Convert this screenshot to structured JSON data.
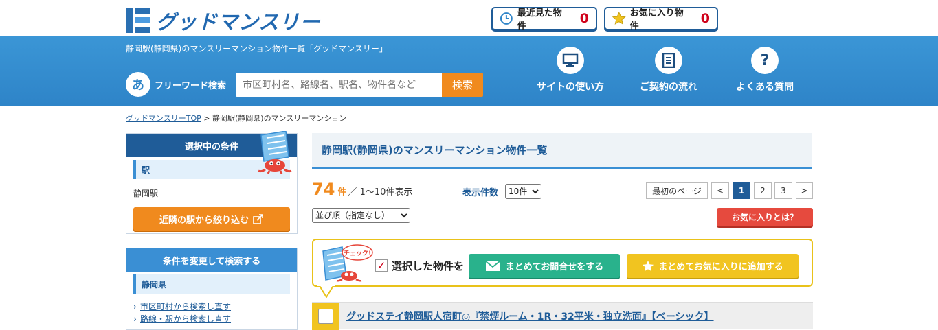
{
  "header": {
    "logo_text": "グッドマンスリー",
    "recent": {
      "label": "最近見た物件",
      "count": "0"
    },
    "favorites": {
      "label": "お気に入り物件",
      "count": "0"
    },
    "page_heading": "静岡駅(静岡県)のマンスリーマンション物件一覧「グッドマンスリー」",
    "freeword": {
      "badge": "あ",
      "label": "フリーワード検索",
      "placeholder": "市区町村名、路線名、駅名、物件名など",
      "button": "検索"
    },
    "nav": [
      {
        "label": "サイトの使い方",
        "icon": "monitor-icon"
      },
      {
        "label": "ご契約の流れ",
        "icon": "document-icon"
      },
      {
        "label": "よくある質問",
        "icon": "question-icon"
      }
    ]
  },
  "breadcrumb": {
    "home": "グッドマンスリーTOP",
    "sep": " > ",
    "current": "静岡駅(静岡県)のマンスリーマンション"
  },
  "sidebar": {
    "conditions": {
      "title": "選択中の条件",
      "sub": "駅",
      "value": "静岡駅",
      "button": "近隣の駅から絞り込む"
    },
    "change": {
      "title": "条件を変更して検索する",
      "sub": "静岡県",
      "links": [
        "市区町村から検索し直す",
        "路線・駅から検索し直す"
      ]
    }
  },
  "main": {
    "title": "静岡駅(静岡県)のマンスリーマンション物件一覧",
    "total": "74",
    "total_unit": "件",
    "range": "／ 1〜10件表示",
    "per_page_label": "表示件数",
    "per_page_value": "10件",
    "pagination": {
      "first": "最初のページ",
      "prev": "<",
      "pages": [
        "1",
        "2",
        "3"
      ],
      "next": ">",
      "current": "1"
    },
    "sort_value": "並び順（指定なし）",
    "fav_help": "お気に入りとは？",
    "selection": {
      "bubble": "チェック!",
      "label": "選択した物件を",
      "inquiry_button": "まとめてお問合せをする",
      "fav_button": "まとめてお気に入りに追加する"
    },
    "listing": {
      "title": "グッドステイ静岡駅人宿町◎『禁煙ルーム・1R・32平米・独立洗面』【ベーシック】"
    }
  },
  "colors": {
    "brand": "#1f5c98",
    "band": "#2e84c8",
    "accent": "#f08a1e",
    "count_red": "#d0021b",
    "teal": "#29b28c",
    "yellow": "#f1c420"
  }
}
